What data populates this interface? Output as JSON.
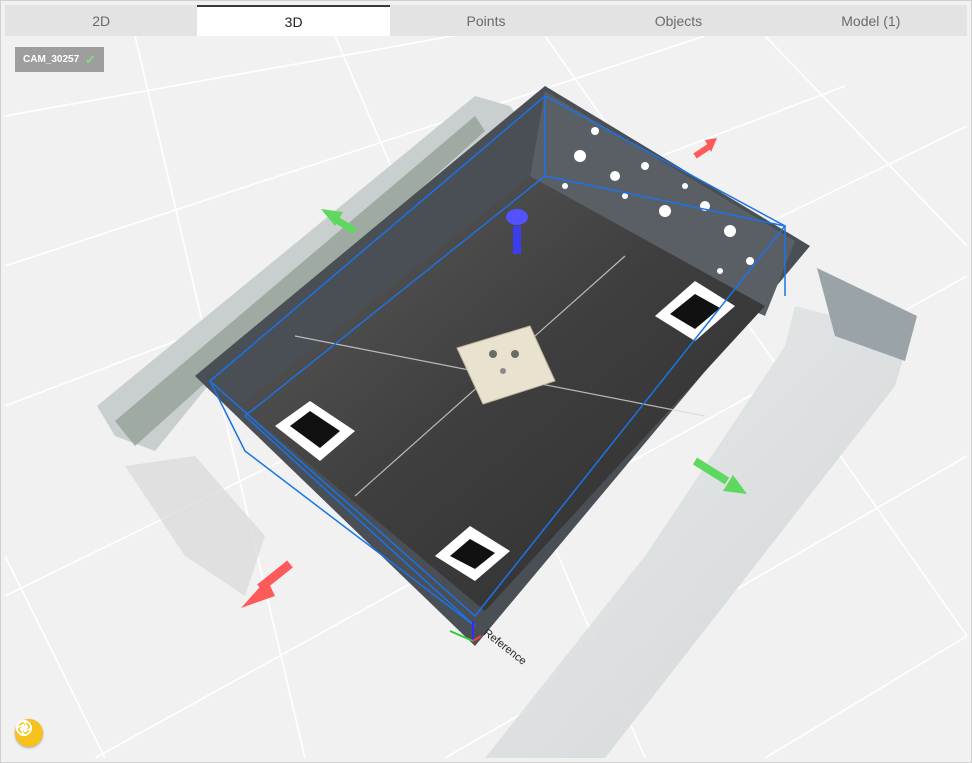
{
  "tabs": [
    {
      "label": "2D"
    },
    {
      "label": "3D"
    },
    {
      "label": "Points"
    },
    {
      "label": "Objects"
    },
    {
      "label": "Model (1)"
    }
  ],
  "active_tab": "3D",
  "camera_badge": {
    "label": "CAM_30257",
    "icon": "check-icon"
  },
  "reference_label": "Reference",
  "capture_button": {
    "icon": "aperture-icon"
  },
  "colors": {
    "tab_active_bg": "#ffffff",
    "tab_bg": "#e3e3e3",
    "bbox": "#1a73e8",
    "capture_button": "#f6c21b"
  }
}
